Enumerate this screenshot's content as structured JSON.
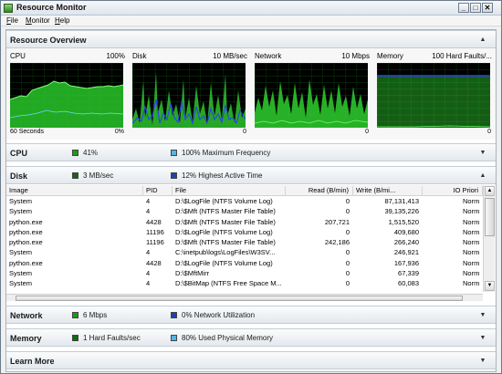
{
  "window": {
    "title": "Resource Monitor",
    "controls": {
      "minimize": "_",
      "maximize": "□",
      "close": "✕"
    }
  },
  "menu": {
    "items": [
      {
        "label": "File",
        "mnemonic": "F",
        "rest": "ile"
      },
      {
        "label": "Monitor",
        "mnemonic": "M",
        "rest": "onitor"
      },
      {
        "label": "Help",
        "mnemonic": "H",
        "rest": "elp"
      }
    ]
  },
  "overview": {
    "title": "Resource Overview",
    "graphs": [
      {
        "label": "CPU",
        "scale": "100%",
        "foot_left": "60 Seconds",
        "foot_right": "0%"
      },
      {
        "label": "Disk",
        "scale": "10 MB/sec",
        "foot_left": "",
        "foot_right": "0"
      },
      {
        "label": "Network",
        "scale": "10 Mbps",
        "foot_left": "",
        "foot_right": "0"
      },
      {
        "label": "Memory",
        "scale": "100 Hard Faults/...",
        "foot_left": "",
        "foot_right": "0"
      }
    ]
  },
  "cpu": {
    "title": "CPU",
    "stat1": "41%",
    "stat2": "100% Maximum Frequency"
  },
  "disk": {
    "title": "Disk",
    "stat1": "3 MB/sec",
    "stat2": "12% Highest Active Time",
    "columns": [
      "Image",
      "PID",
      "File",
      "Read (B/min)",
      "Write (B/mi...",
      "IO Priori"
    ],
    "rows": [
      [
        "System",
        "4",
        "D:\\$LogFile (NTFS Volume Log)",
        "0",
        "87,131,413",
        "Norm"
      ],
      [
        "System",
        "4",
        "D:\\$Mft (NTFS Master File Table)",
        "0",
        "39,135,226",
        "Norm"
      ],
      [
        "python.exe",
        "4428",
        "D:\\$Mft (NTFS Master File Table)",
        "207,721",
        "1,515,520",
        "Norm"
      ],
      [
        "python.exe",
        "11196",
        "D:\\$LogFile (NTFS Volume Log)",
        "0",
        "409,680",
        "Norm"
      ],
      [
        "python.exe",
        "11196",
        "D:\\$Mft (NTFS Master File Table)",
        "242,186",
        "266,240",
        "Norm"
      ],
      [
        "System",
        "4",
        "C:\\inetpub\\logs\\LogFiles\\W3SV...",
        "0",
        "246,921",
        "Norm"
      ],
      [
        "python.exe",
        "4428",
        "D:\\$LogFile (NTFS Volume Log)",
        "0",
        "167,936",
        "Norm"
      ],
      [
        "System",
        "4",
        "D:\\$MftMirr",
        "0",
        "67,339",
        "Norm"
      ],
      [
        "System",
        "4",
        "D:\\$BitMap (NTFS Free Space M...",
        "0",
        "60,083",
        "Norm"
      ]
    ]
  },
  "network": {
    "title": "Network",
    "stat1": "6 Mbps",
    "stat2": "0% Network Utilization"
  },
  "memory": {
    "title": "Memory",
    "stat1": "1 Hard Faults/sec",
    "stat2": "80% Used Physical Memory"
  },
  "learn_more": {
    "title": "Learn More"
  },
  "colors": {
    "green": "#1a9a1a",
    "blue": "#2040b0",
    "light_blue": "#4fb7e8",
    "dark_green": "#0e6b0e"
  }
}
